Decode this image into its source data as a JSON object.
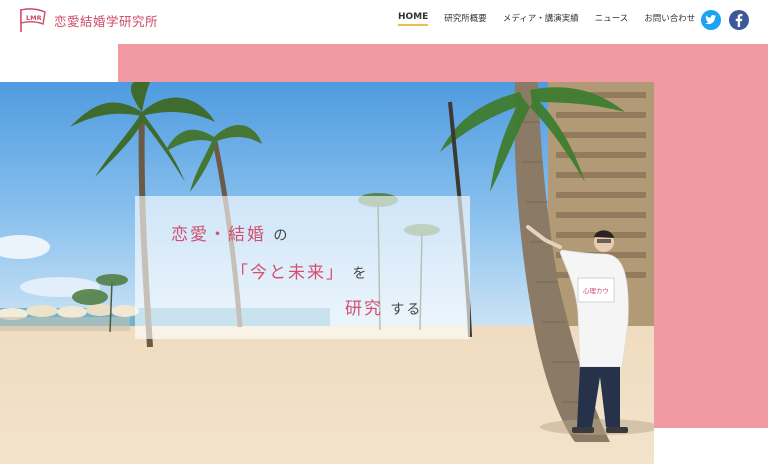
{
  "header": {
    "logo_text": "恋愛結婚学研究所",
    "logo_badge": "LMR"
  },
  "nav": {
    "items": [
      {
        "label": "HOME",
        "active": true
      },
      {
        "label": "研究所概要",
        "active": false
      },
      {
        "label": "メディア・講演実績",
        "active": false
      },
      {
        "label": "ニュース",
        "active": false
      },
      {
        "label": "お問い合わせ",
        "active": false
      }
    ]
  },
  "social": {
    "twitter_icon": "twitter-icon",
    "facebook_icon": "facebook-icon"
  },
  "hero": {
    "line1_main": "恋愛・結婚",
    "line1_particle": "の",
    "line2_main": "「今と未来」",
    "line2_particle": "を",
    "line3_main": "研究",
    "line3_particle": "する",
    "sign_text": "心理カウ"
  },
  "colors": {
    "brand_pink": "#d0486a",
    "backdrop_pink": "#f29aa3",
    "nav_underline": "#e9c14a",
    "twitter_blue": "#1da1f2",
    "facebook_blue": "#3b5998"
  }
}
